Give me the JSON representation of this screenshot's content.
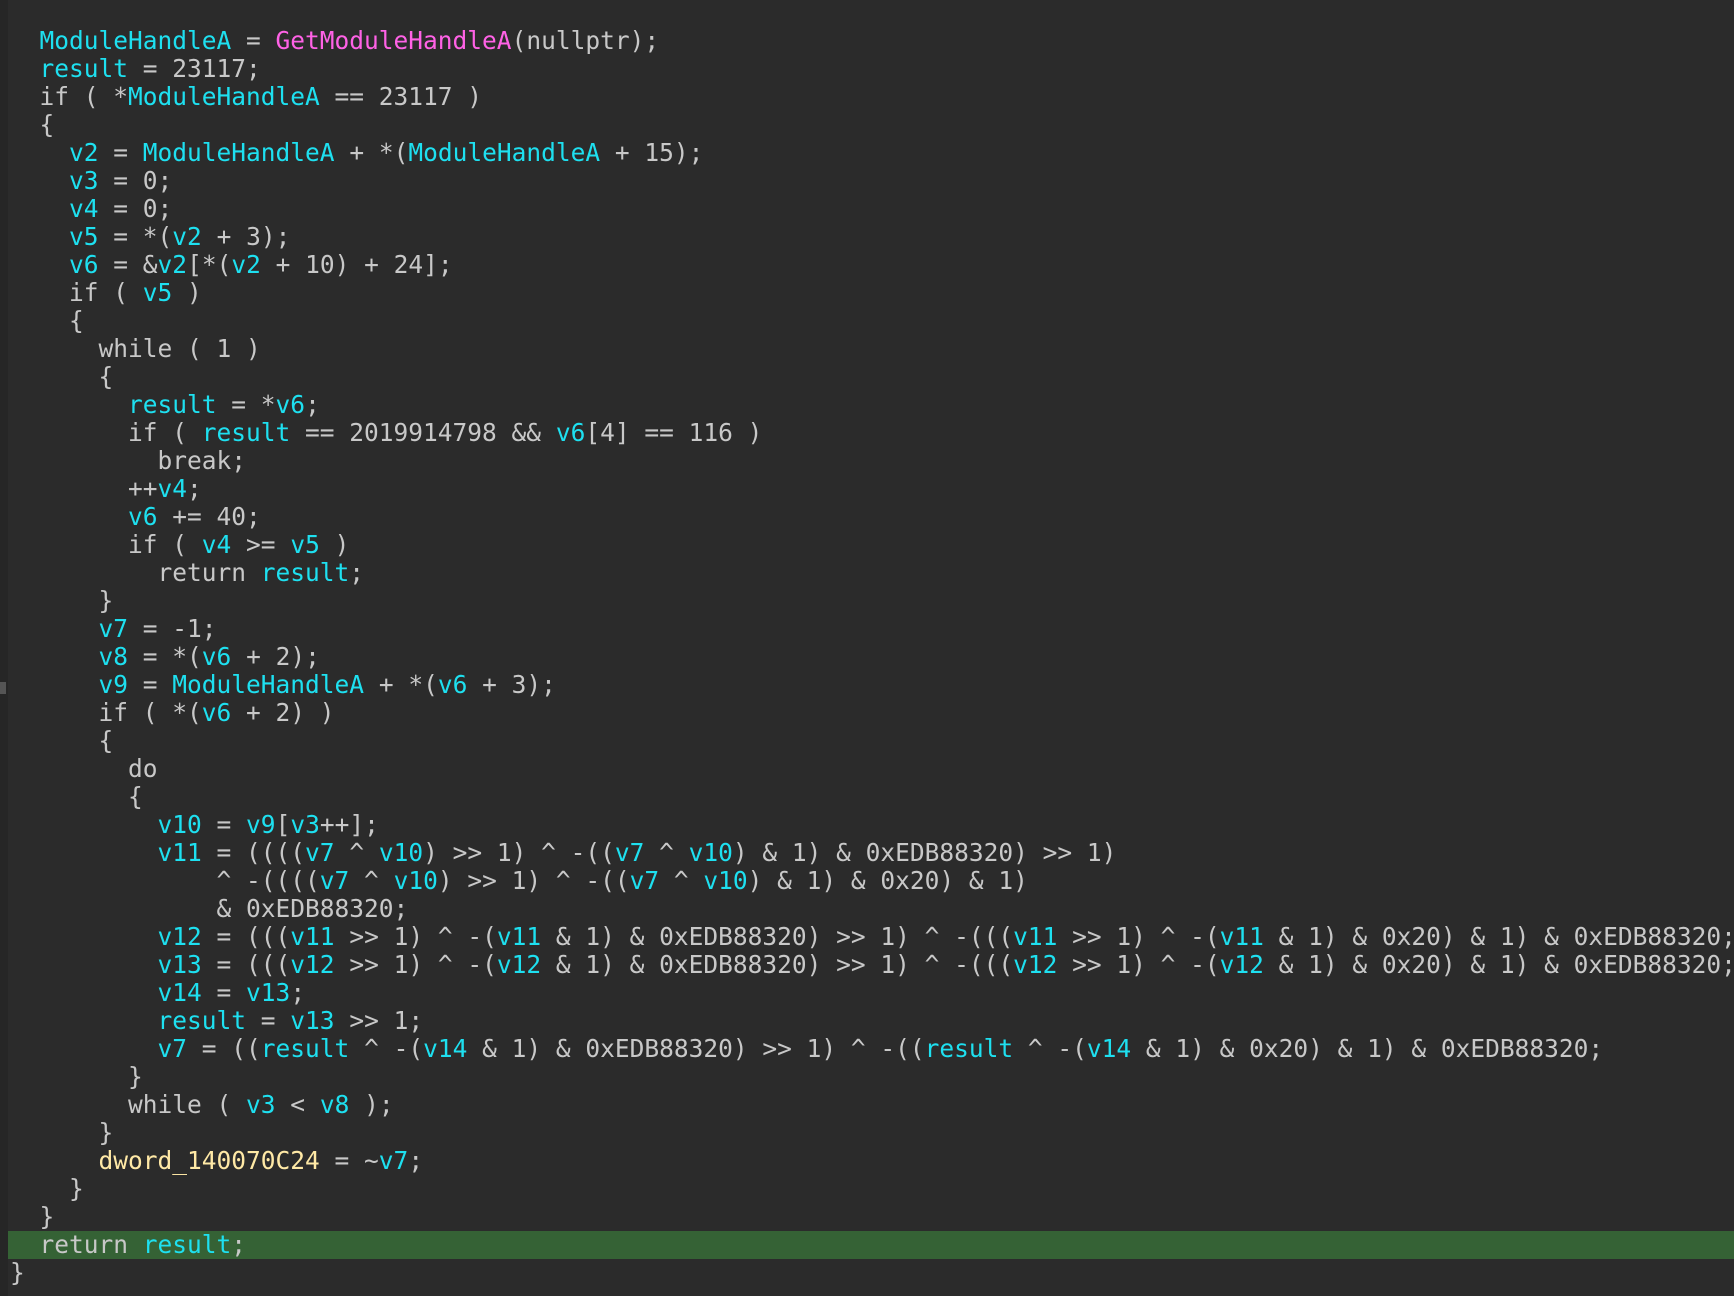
{
  "colors": {
    "background": "#2b2b2b",
    "text": "#c8c8c8",
    "variable": "#1ee0f0",
    "function": "#ff62e6",
    "global": "#ffe9a6",
    "current_line_highlight": "#356235"
  },
  "code": {
    "highlighted_line": 43,
    "lines": [
      {
        "indent": 1,
        "tokens": [
          [
            "v",
            "ModuleHandleA"
          ],
          [
            "p",
            " = "
          ],
          [
            "f",
            "GetModuleHandleA"
          ],
          [
            "p",
            "(nullptr);"
          ]
        ]
      },
      {
        "indent": 1,
        "tokens": [
          [
            "v",
            "result"
          ],
          [
            "p",
            " = 23117;"
          ]
        ]
      },
      {
        "indent": 1,
        "tokens": [
          [
            "p",
            "if ( *"
          ],
          [
            "v",
            "ModuleHandleA"
          ],
          [
            "p",
            " == 23117 )"
          ]
        ]
      },
      {
        "indent": 1,
        "tokens": [
          [
            "p",
            "{"
          ]
        ]
      },
      {
        "indent": 2,
        "tokens": [
          [
            "v",
            "v2"
          ],
          [
            "p",
            " = "
          ],
          [
            "v",
            "ModuleHandleA"
          ],
          [
            "p",
            " + *("
          ],
          [
            "v",
            "ModuleHandleA"
          ],
          [
            "p",
            " + 15);"
          ]
        ]
      },
      {
        "indent": 2,
        "tokens": [
          [
            "v",
            "v3"
          ],
          [
            "p",
            " = 0;"
          ]
        ]
      },
      {
        "indent": 2,
        "tokens": [
          [
            "v",
            "v4"
          ],
          [
            "p",
            " = 0;"
          ]
        ]
      },
      {
        "indent": 2,
        "tokens": [
          [
            "v",
            "v5"
          ],
          [
            "p",
            " = *("
          ],
          [
            "v",
            "v2"
          ],
          [
            "p",
            " + 3);"
          ]
        ]
      },
      {
        "indent": 2,
        "tokens": [
          [
            "v",
            "v6"
          ],
          [
            "p",
            " = &"
          ],
          [
            "v",
            "v2"
          ],
          [
            "p",
            "[*("
          ],
          [
            "v",
            "v2"
          ],
          [
            "p",
            " + 10) + 24];"
          ]
        ]
      },
      {
        "indent": 2,
        "tokens": [
          [
            "p",
            "if ( "
          ],
          [
            "v",
            "v5"
          ],
          [
            "p",
            " )"
          ]
        ]
      },
      {
        "indent": 2,
        "tokens": [
          [
            "p",
            "{"
          ]
        ]
      },
      {
        "indent": 3,
        "tokens": [
          [
            "p",
            "while ( 1 )"
          ]
        ]
      },
      {
        "indent": 3,
        "tokens": [
          [
            "p",
            "{"
          ]
        ]
      },
      {
        "indent": 4,
        "tokens": [
          [
            "v",
            "result"
          ],
          [
            "p",
            " = *"
          ],
          [
            "v",
            "v6"
          ],
          [
            "p",
            ";"
          ]
        ]
      },
      {
        "indent": 4,
        "tokens": [
          [
            "p",
            "if ( "
          ],
          [
            "v",
            "result"
          ],
          [
            "p",
            " == 2019914798 && "
          ],
          [
            "v",
            "v6"
          ],
          [
            "p",
            "[4] == 116 )"
          ]
        ]
      },
      {
        "indent": 5,
        "tokens": [
          [
            "p",
            "break;"
          ]
        ]
      },
      {
        "indent": 4,
        "tokens": [
          [
            "p",
            "++"
          ],
          [
            "v",
            "v4"
          ],
          [
            "p",
            ";"
          ]
        ]
      },
      {
        "indent": 4,
        "tokens": [
          [
            "v",
            "v6"
          ],
          [
            "p",
            " += 40;"
          ]
        ]
      },
      {
        "indent": 4,
        "tokens": [
          [
            "p",
            "if ( "
          ],
          [
            "v",
            "v4"
          ],
          [
            "p",
            " >= "
          ],
          [
            "v",
            "v5"
          ],
          [
            "p",
            " )"
          ]
        ]
      },
      {
        "indent": 5,
        "tokens": [
          [
            "p",
            "return "
          ],
          [
            "v",
            "result"
          ],
          [
            "p",
            ";"
          ]
        ]
      },
      {
        "indent": 3,
        "tokens": [
          [
            "p",
            "}"
          ]
        ]
      },
      {
        "indent": 3,
        "tokens": [
          [
            "v",
            "v7"
          ],
          [
            "p",
            " = -1;"
          ]
        ]
      },
      {
        "indent": 3,
        "tokens": [
          [
            "v",
            "v8"
          ],
          [
            "p",
            " = *("
          ],
          [
            "v",
            "v6"
          ],
          [
            "p",
            " + 2);"
          ]
        ]
      },
      {
        "indent": 3,
        "tokens": [
          [
            "v",
            "v9"
          ],
          [
            "p",
            " = "
          ],
          [
            "v",
            "ModuleHandleA"
          ],
          [
            "p",
            " + *("
          ],
          [
            "v",
            "v6"
          ],
          [
            "p",
            " + 3);"
          ]
        ]
      },
      {
        "indent": 3,
        "tokens": [
          [
            "p",
            "if ( *("
          ],
          [
            "v",
            "v6"
          ],
          [
            "p",
            " + 2) )"
          ]
        ]
      },
      {
        "indent": 3,
        "tokens": [
          [
            "p",
            "{"
          ]
        ]
      },
      {
        "indent": 4,
        "tokens": [
          [
            "p",
            "do"
          ]
        ]
      },
      {
        "indent": 4,
        "tokens": [
          [
            "p",
            "{"
          ]
        ]
      },
      {
        "indent": 5,
        "tokens": [
          [
            "v",
            "v10"
          ],
          [
            "p",
            " = "
          ],
          [
            "v",
            "v9"
          ],
          [
            "p",
            "["
          ],
          [
            "v",
            "v3"
          ],
          [
            "p",
            "++];"
          ]
        ]
      },
      {
        "indent": 5,
        "tokens": [
          [
            "v",
            "v11"
          ],
          [
            "p",
            " = (((("
          ],
          [
            "v",
            "v7"
          ],
          [
            "p",
            " ^ "
          ],
          [
            "v",
            "v10"
          ],
          [
            "p",
            ") >> 1) ^ -(("
          ],
          [
            "v",
            "v7"
          ],
          [
            "p",
            " ^ "
          ],
          [
            "v",
            "v10"
          ],
          [
            "p",
            ") & 1) & 0xEDB88320) >> 1)"
          ]
        ]
      },
      {
        "indent": 7,
        "tokens": [
          [
            "p",
            "^ -(((("
          ],
          [
            "v",
            "v7"
          ],
          [
            "p",
            " ^ "
          ],
          [
            "v",
            "v10"
          ],
          [
            "p",
            ") >> 1) ^ -(("
          ],
          [
            "v",
            "v7"
          ],
          [
            "p",
            " ^ "
          ],
          [
            "v",
            "v10"
          ],
          [
            "p",
            ") & 1) & 0x20) & 1)"
          ]
        ]
      },
      {
        "indent": 7,
        "tokens": [
          [
            "p",
            "& 0xEDB88320;"
          ]
        ]
      },
      {
        "indent": 5,
        "tokens": [
          [
            "v",
            "v12"
          ],
          [
            "p",
            " = ((("
          ],
          [
            "v",
            "v11"
          ],
          [
            "p",
            " >> 1) ^ -("
          ],
          [
            "v",
            "v11"
          ],
          [
            "p",
            " & 1) & 0xEDB88320) >> 1) ^ -((("
          ],
          [
            "v",
            "v11"
          ],
          [
            "p",
            " >> 1) ^ -("
          ],
          [
            "v",
            "v11"
          ],
          [
            "p",
            " & 1) & 0x20) & 1) & 0xEDB88320;"
          ]
        ]
      },
      {
        "indent": 5,
        "tokens": [
          [
            "v",
            "v13"
          ],
          [
            "p",
            " = ((("
          ],
          [
            "v",
            "v12"
          ],
          [
            "p",
            " >> 1) ^ -("
          ],
          [
            "v",
            "v12"
          ],
          [
            "p",
            " & 1) & 0xEDB88320) >> 1) ^ -((("
          ],
          [
            "v",
            "v12"
          ],
          [
            "p",
            " >> 1) ^ -("
          ],
          [
            "v",
            "v12"
          ],
          [
            "p",
            " & 1) & 0x20) & 1) & 0xEDB88320;"
          ]
        ]
      },
      {
        "indent": 5,
        "tokens": [
          [
            "v",
            "v14"
          ],
          [
            "p",
            " = "
          ],
          [
            "v",
            "v13"
          ],
          [
            "p",
            ";"
          ]
        ]
      },
      {
        "indent": 5,
        "tokens": [
          [
            "v",
            "result"
          ],
          [
            "p",
            " = "
          ],
          [
            "v",
            "v13"
          ],
          [
            "p",
            " >> 1;"
          ]
        ]
      },
      {
        "indent": 5,
        "tokens": [
          [
            "v",
            "v7"
          ],
          [
            "p",
            " = (("
          ],
          [
            "v",
            "result"
          ],
          [
            "p",
            " ^ -("
          ],
          [
            "v",
            "v14"
          ],
          [
            "p",
            " & 1) & 0xEDB88320) >> 1) ^ -(("
          ],
          [
            "v",
            "result"
          ],
          [
            "p",
            " ^ -("
          ],
          [
            "v",
            "v14"
          ],
          [
            "p",
            " & 1) & 0x20) & 1) & 0xEDB88320;"
          ]
        ]
      },
      {
        "indent": 4,
        "tokens": [
          [
            "p",
            "}"
          ]
        ]
      },
      {
        "indent": 4,
        "tokens": [
          [
            "p",
            "while ( "
          ],
          [
            "v",
            "v3"
          ],
          [
            "p",
            " < "
          ],
          [
            "v",
            "v8"
          ],
          [
            "p",
            " );"
          ]
        ]
      },
      {
        "indent": 3,
        "tokens": [
          [
            "p",
            "}"
          ]
        ]
      },
      {
        "indent": 3,
        "tokens": [
          [
            "g",
            "dword_140070C24"
          ],
          [
            "p",
            " = ~"
          ],
          [
            "v",
            "v7"
          ],
          [
            "p",
            ";"
          ]
        ]
      },
      {
        "indent": 2,
        "tokens": [
          [
            "p",
            "}"
          ]
        ]
      },
      {
        "indent": 1,
        "tokens": [
          [
            "p",
            "}"
          ]
        ]
      },
      {
        "indent": 1,
        "tokens": [
          [
            "p",
            "return "
          ],
          [
            "v",
            "result"
          ],
          [
            "p",
            ";"
          ]
        ]
      },
      {
        "indent": 0,
        "tokens": [
          [
            "p",
            "}"
          ]
        ]
      }
    ]
  }
}
